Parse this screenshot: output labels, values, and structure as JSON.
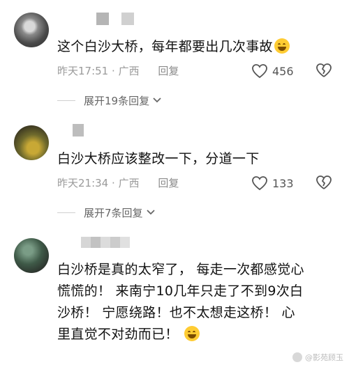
{
  "comments": [
    {
      "text": "这个白沙大桥，每年都要出几次事故",
      "time": "昨天17:51",
      "separator": "·",
      "location": "广西",
      "reply_label": "回复",
      "likes": "456",
      "expand_label": "展开19条回复",
      "emoji": "laughing-with-tears-emoji"
    },
    {
      "text": "白沙大桥应该整改一下，分道一下",
      "time": "昨天21:34",
      "separator": "·",
      "location": "广西",
      "reply_label": "回复",
      "likes": "133",
      "expand_label": "展开7条回复"
    },
    {
      "lines": [
        "白沙桥是真的太窄了，  每走一次都感觉心",
        "慌慌的！  来南宁10几年只走了不到9次白",
        "沙桥！  宁愿绕路！也不太想走这桥！  心",
        "里直觉不对劲而已！"
      ],
      "emoji": "grinning-emoji"
    }
  ],
  "watermark": "@影苑顾玉",
  "colors": {
    "meta": "#9a9a9a",
    "text": "#111111",
    "emoji": "#ffcc33"
  }
}
